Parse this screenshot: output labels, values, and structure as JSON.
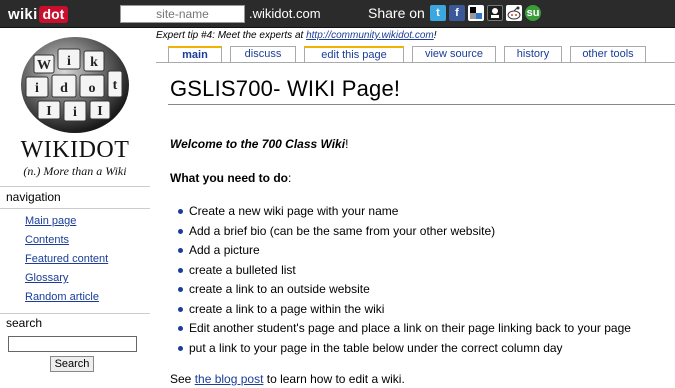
{
  "topbar": {
    "logo_wiki": "wiki",
    "logo_dot": "dot",
    "site_placeholder": "site-name",
    "domain_suffix": ".wikidot.com",
    "share_label": "Share on",
    "share_icons": [
      "twitter-icon",
      "facebook-icon",
      "delicious-icon",
      "digg-icon",
      "reddit-icon",
      "stumbleupon-icon"
    ]
  },
  "sidebar": {
    "logo_word": "WIKIDOT",
    "logo_tagline": "(n.) More than a Wiki",
    "nav_title": "navigation",
    "nav_items": [
      {
        "label": "Main page"
      },
      {
        "label": "Contents"
      },
      {
        "label": "Featured content"
      },
      {
        "label": "Glossary"
      },
      {
        "label": "Random article"
      }
    ],
    "search_title": "search",
    "search_button": "Search"
  },
  "tip": {
    "prefix": "Expert tip #4: Meet the experts at ",
    "link": "http://community.wikidot.com",
    "suffix": "!"
  },
  "tabs": [
    {
      "label": "main",
      "active": true
    },
    {
      "label": "discuss",
      "active": false
    },
    {
      "label": "edit this page",
      "active": false
    },
    {
      "label": "view source",
      "active": false
    },
    {
      "label": "history",
      "active": false
    },
    {
      "label": "other tools",
      "active": false
    }
  ],
  "content": {
    "page_title": "GSLIS700- WIKI Page!",
    "welcome_bold": "Welcome to the 700 Class Wiki",
    "welcome_end": "!",
    "need_bold": "What you need to do",
    "need_end": ":",
    "tasks": [
      "Create a new wiki page with your name",
      "Add a brief bio (can be the same from your other website)",
      "Add a picture",
      "create a bulleted list",
      "create a link to an outside website",
      "create a link to a page within the wiki",
      "Edit another student's page and place a link on their page linking back to your page",
      "put a link to your page in the table below under the correct column day"
    ],
    "see_prefix": "See ",
    "see_link": "the blog post",
    "see_suffix": " to learn how to edit a wiki."
  },
  "colors": {
    "topbar_bg": "#2b2b2b",
    "logo_red": "#c8102e",
    "link": "#1a3d99",
    "tab_accent": "#f2b200"
  }
}
